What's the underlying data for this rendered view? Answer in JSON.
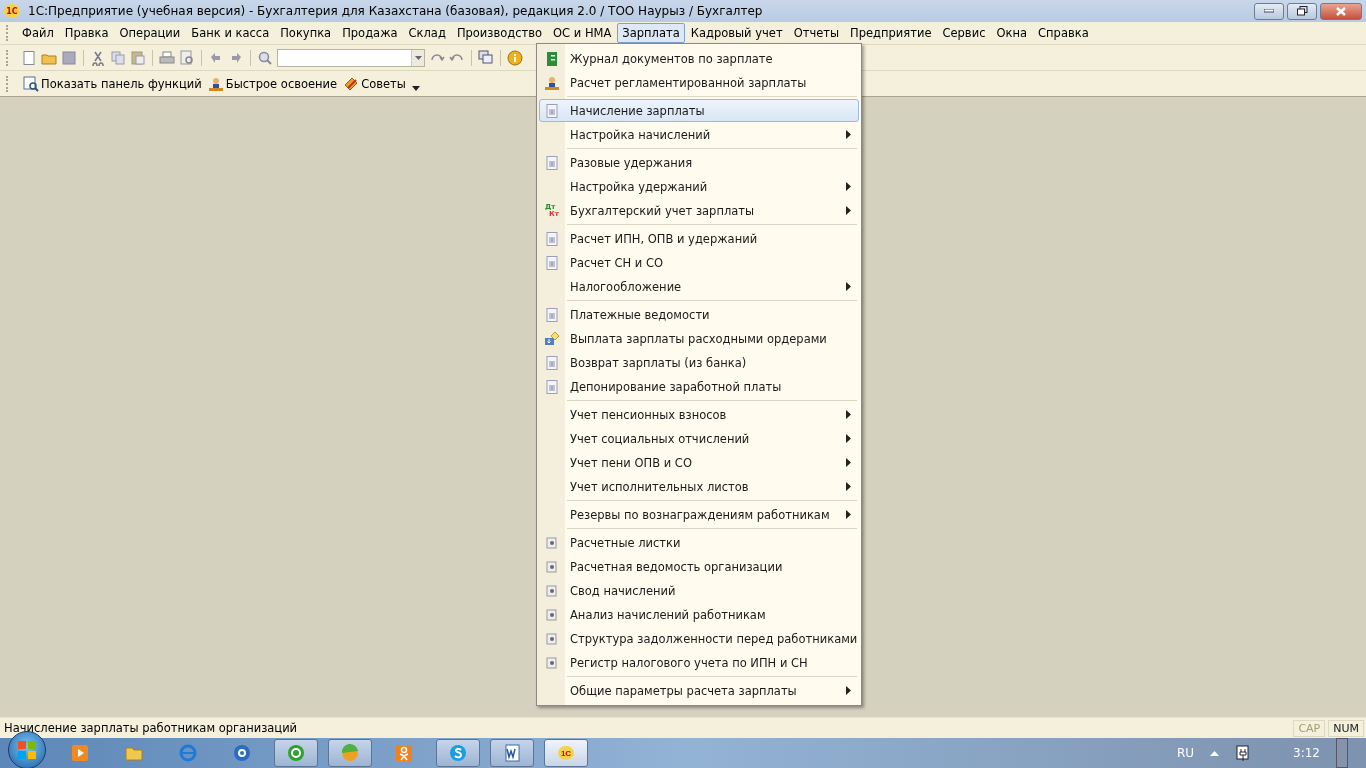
{
  "window": {
    "title": "1С:Предприятие (учебная версия) - Бухгалтерия для Казахстана (базовая), редакция 2.0 / ТОО Наурыз / Бухгалтер",
    "app_badge": "1С"
  },
  "menu_bar": [
    {
      "label": "Файл",
      "selected": false
    },
    {
      "label": "Правка",
      "selected": false
    },
    {
      "label": "Операции",
      "selected": false
    },
    {
      "label": "Банк и касса",
      "selected": false
    },
    {
      "label": "Покупка",
      "selected": false
    },
    {
      "label": "Продажа",
      "selected": false
    },
    {
      "label": "Склад",
      "selected": false
    },
    {
      "label": "Производство",
      "selected": false
    },
    {
      "label": "ОС и НМА",
      "selected": false
    },
    {
      "label": "Зарплата",
      "selected": true
    },
    {
      "label": "Кадровый учет",
      "selected": false
    },
    {
      "label": "Отчеты",
      "selected": false
    },
    {
      "label": "Предприятие",
      "selected": false
    },
    {
      "label": "Сервис",
      "selected": false
    },
    {
      "label": "Окна",
      "selected": false
    },
    {
      "label": "Справка",
      "selected": false
    }
  ],
  "panel_bar": [
    {
      "label": "Показать панель функций",
      "kind": "panel"
    },
    {
      "label": "Быстрое освоение",
      "kind": "person"
    },
    {
      "label": "Советы",
      "kind": "tips"
    }
  ],
  "dropdown": [
    [
      {
        "label": "Журнал документов по зарплате",
        "kind": "journal",
        "submenu": false,
        "selected": false
      },
      {
        "label": "Расчет регламентированной зарплаты",
        "kind": "person",
        "submenu": false,
        "selected": false
      }
    ],
    [
      {
        "label": "Начисление зарплаты",
        "kind": "doc",
        "submenu": false,
        "selected": true
      },
      {
        "label": "Настройка начислений",
        "kind": "plain",
        "submenu": true,
        "selected": false
      }
    ],
    [
      {
        "label": "Разовые удержания",
        "kind": "doc",
        "submenu": false,
        "selected": false
      },
      {
        "label": "Настройка удержаний",
        "kind": "plain",
        "submenu": true,
        "selected": false
      },
      {
        "label": "Бухгалтерский учет зарплаты",
        "kind": "dtkt",
        "icon_text": [
          "Дт",
          "Кт"
        ],
        "submenu": true,
        "selected": false
      }
    ],
    [
      {
        "label": "Расчет ИПН, ОПВ и удержаний",
        "kind": "doc",
        "submenu": false,
        "selected": false
      },
      {
        "label": "Расчет СН и СО",
        "kind": "doc",
        "submenu": false,
        "selected": false
      },
      {
        "label": "Налогообложение",
        "kind": "plain",
        "submenu": true,
        "selected": false
      }
    ],
    [
      {
        "label": "Платежные ведомости",
        "kind": "doc",
        "submenu": false,
        "selected": false
      },
      {
        "label": "Выплата зарплаты расходными ордерами",
        "kind": "payout",
        "submenu": false,
        "selected": false
      },
      {
        "label": "Возврат зарплаты (из банка)",
        "kind": "doc",
        "submenu": false,
        "selected": false
      },
      {
        "label": "Депонирование заработной платы",
        "kind": "doc",
        "submenu": false,
        "selected": false
      }
    ],
    [
      {
        "label": "Учет пенсионных взносов",
        "kind": "plain",
        "submenu": true,
        "selected": false
      },
      {
        "label": "Учет социальных отчислений",
        "kind": "plain",
        "submenu": true,
        "selected": false
      },
      {
        "label": "Учет пени ОПВ и СО",
        "kind": "plain",
        "submenu": true,
        "selected": false
      },
      {
        "label": "Учет исполнительных листов",
        "kind": "plain",
        "submenu": true,
        "selected": false
      }
    ],
    [
      {
        "label": "Резервы по вознаграждениям работникам",
        "kind": "plain",
        "submenu": true,
        "selected": false
      }
    ],
    [
      {
        "label": "Расчетные листки",
        "kind": "report",
        "submenu": false,
        "selected": false
      },
      {
        "label": "Расчетная ведомость организации",
        "kind": "report",
        "submenu": false,
        "selected": false
      },
      {
        "label": "Свод начислений",
        "kind": "report",
        "submenu": false,
        "selected": false
      },
      {
        "label": "Анализ начислений работникам",
        "kind": "report",
        "submenu": false,
        "selected": false
      },
      {
        "label": "Структура задолженности перед работниками",
        "kind": "report",
        "submenu": false,
        "selected": false
      },
      {
        "label": "Регистр налогового учета по ИПН и СН",
        "kind": "report",
        "submenu": false,
        "selected": false
      }
    ],
    [
      {
        "label": "Общие параметры расчета зарплаты",
        "kind": "plain",
        "submenu": true,
        "selected": false
      }
    ]
  ],
  "status_bar": {
    "text": "Начисление зарплаты работникам организаций",
    "indicators": [
      {
        "label": "CAP",
        "on": false
      },
      {
        "label": "NUM",
        "on": true
      }
    ]
  },
  "taskbar": {
    "apps": [
      {
        "kind": "media",
        "selected": false,
        "pinned": false
      },
      {
        "kind": "folder",
        "selected": false,
        "pinned": false
      },
      {
        "kind": "browser",
        "selected": false,
        "pinned": false
      },
      {
        "kind": "mail",
        "selected": false,
        "pinned": false
      },
      {
        "kind": "agent",
        "selected": false,
        "pinned": true
      },
      {
        "kind": "ball",
        "selected": false,
        "pinned": true
      },
      {
        "kind": "ok",
        "selected": false,
        "pinned": false
      },
      {
        "kind": "skype",
        "selected": false,
        "pinned": true
      },
      {
        "kind": "word",
        "selected": false,
        "pinned": true
      },
      {
        "kind": "onec",
        "selected": true,
        "pinned": true,
        "badge": "1С"
      }
    ],
    "language": "RU",
    "time": "3:12"
  }
}
